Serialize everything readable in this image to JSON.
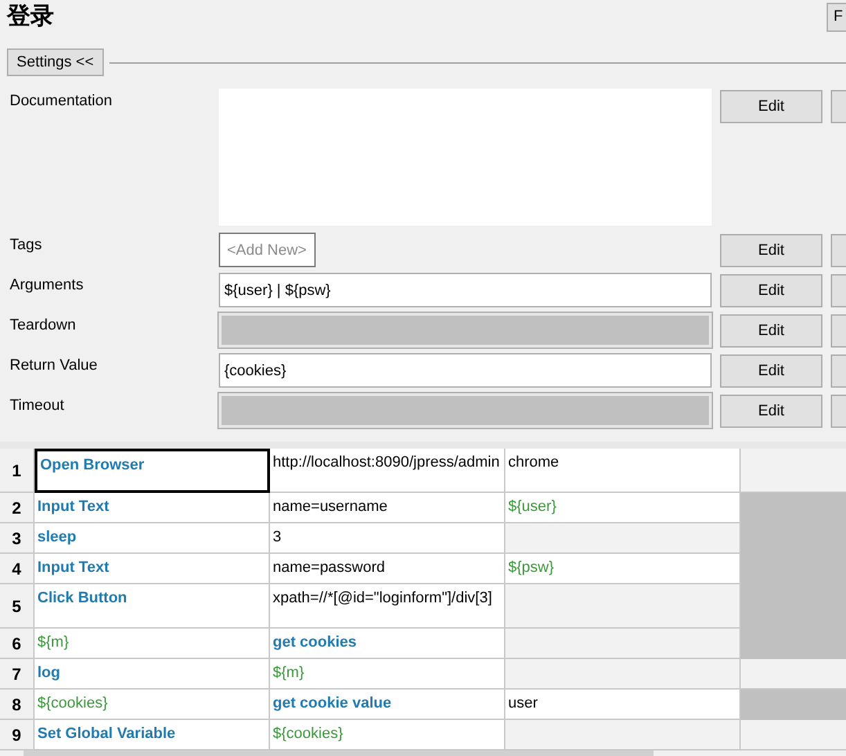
{
  "title": "登录",
  "top_button": "F",
  "settings_toggle": "Settings <<",
  "settings": [
    {
      "label": "Documentation",
      "kind": "textarea",
      "edit": "Edit"
    },
    {
      "label": "Tags",
      "kind": "tags",
      "placeholder": "<Add New>",
      "edit": "Edit"
    },
    {
      "label": "Arguments",
      "kind": "field",
      "value": "${user} | ${psw}",
      "edit": "Edit"
    },
    {
      "label": "Teardown",
      "kind": "disabled",
      "edit": "Edit"
    },
    {
      "label": "Return Value",
      "kind": "field",
      "value": "{cookies}",
      "edit": "Edit"
    },
    {
      "label": "Timeout",
      "kind": "disabled",
      "edit": "Edit"
    }
  ],
  "grid": {
    "rows": [
      {
        "number": "1",
        "tall": true,
        "shaded_end": false,
        "cells": [
          {
            "text": "Open Browser",
            "kind": "keyword",
            "selected": true
          },
          {
            "text": "http://localhost:8090/jpress/admin",
            "kind": "plain",
            "selected": false
          },
          {
            "text": "chrome",
            "kind": "plain",
            "selected": false
          }
        ]
      },
      {
        "number": "2",
        "tall": false,
        "shaded_end": true,
        "cells": [
          {
            "text": "Input Text",
            "kind": "keyword",
            "selected": false
          },
          {
            "text": "name=username",
            "kind": "plain",
            "selected": false
          },
          {
            "text": "${user}",
            "kind": "variable",
            "selected": false
          }
        ]
      },
      {
        "number": "3",
        "tall": false,
        "shaded_end": true,
        "cells": [
          {
            "text": "sleep",
            "kind": "keyword",
            "selected": false
          },
          {
            "text": "3",
            "kind": "plain",
            "selected": false
          }
        ]
      },
      {
        "number": "4",
        "tall": false,
        "shaded_end": true,
        "cells": [
          {
            "text": "Input Text",
            "kind": "keyword",
            "selected": false
          },
          {
            "text": "name=password",
            "kind": "plain",
            "selected": false
          },
          {
            "text": "${psw}",
            "kind": "variable",
            "selected": false
          }
        ]
      },
      {
        "number": "5",
        "tall": true,
        "shaded_end": true,
        "cells": [
          {
            "text": "Click Button",
            "kind": "keyword",
            "selected": false
          },
          {
            "text": "xpath=//*[@id=\"loginform\"]/div[3]",
            "kind": "plain",
            "selected": false
          }
        ]
      },
      {
        "number": "6",
        "tall": false,
        "shaded_end": true,
        "cells": [
          {
            "text": "${m}",
            "kind": "variable",
            "selected": false
          },
          {
            "text": "get cookies",
            "kind": "keyword",
            "selected": false
          }
        ]
      },
      {
        "number": "7",
        "tall": false,
        "shaded_end": false,
        "cells": [
          {
            "text": "log",
            "kind": "keyword",
            "selected": false
          },
          {
            "text": "${m}",
            "kind": "variable",
            "selected": false
          }
        ]
      },
      {
        "number": "8",
        "tall": false,
        "shaded_end": true,
        "cells": [
          {
            "text": "${cookies}",
            "kind": "variable",
            "selected": false
          },
          {
            "text": "get cookie value",
            "kind": "keyword",
            "selected": false
          },
          {
            "text": "user",
            "kind": "plain",
            "selected": false
          }
        ]
      },
      {
        "number": "9",
        "tall": false,
        "shaded_end": false,
        "cells": [
          {
            "text": "Set Global Variable",
            "kind": "keyword",
            "selected": false
          },
          {
            "text": "${cookies}",
            "kind": "variable",
            "selected": false
          }
        ]
      }
    ]
  }
}
